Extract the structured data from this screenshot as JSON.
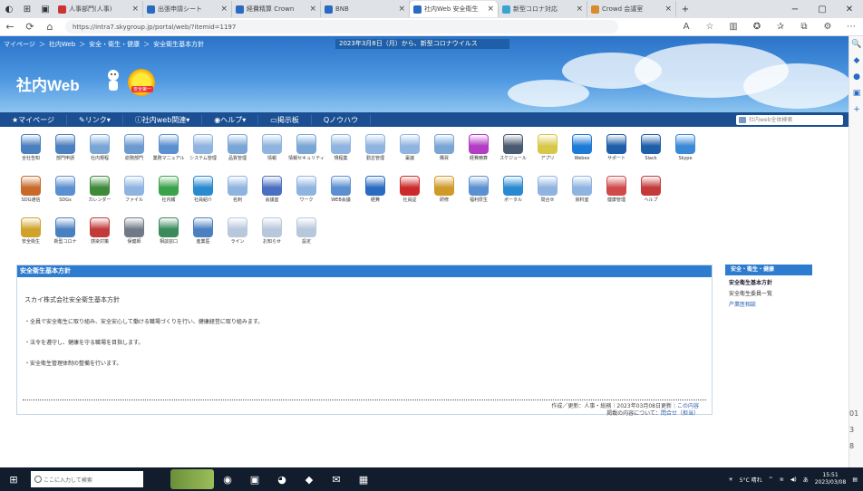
{
  "browser": {
    "tabs": [
      {
        "label": "人事部門(人事)",
        "color": "#cc3333"
      },
      {
        "label": "出張申請シート",
        "color": "#2a6bc2"
      },
      {
        "label": "経費精算 Crown",
        "color": "#2a6bc2"
      },
      {
        "label": "BNB",
        "color": "#2a6bc2"
      },
      {
        "label": "社内Web 安全衛生",
        "color": "#2a6bc2",
        "active": true
      },
      {
        "label": "新型コロナ対応",
        "color": "#3aa3d0"
      },
      {
        "label": "Crowd 会議室",
        "color": "#d98a2a"
      }
    ],
    "url": "https://intra7.skygroup.jp/portal/web/?itemid=1197",
    "new_tab": "+",
    "window_controls": [
      "−",
      "▢",
      "✕"
    ]
  },
  "banner": {
    "breadcrumb": [
      "マイページ",
      "社内Web",
      "安全・衛生・健康",
      "安全衛生基本方針"
    ],
    "notice": "2023年3月8日（月）から、新型コロナウイルス",
    "logo": "社内Web",
    "sun_label": "安全第一"
  },
  "nav": {
    "items": [
      "マイページ",
      "リンク",
      "社内web関連",
      "ヘルプ",
      "掲示板",
      "ノウハウ"
    ],
    "search_placeholder": "社内web全体検索"
  },
  "links": [
    {
      "label": "全社告知",
      "color": "#4a7fc0"
    },
    {
      "label": "部門申請",
      "color": "#4a7fc0"
    },
    {
      "label": "社内規程",
      "color": "#7aa6d6"
    },
    {
      "label": "総務部門",
      "color": "#6c9bd0"
    },
    {
      "label": "業務マニュアル",
      "color": "#5a8fd0"
    },
    {
      "label": "システム管理",
      "color": "#8fb4e0"
    },
    {
      "label": "品質管理",
      "color": "#7aa6d6"
    },
    {
      "label": "情報",
      "color": "#8fb4e0"
    },
    {
      "label": "情報セキュリティ",
      "color": "#7aa6d6"
    },
    {
      "label": "規程集",
      "color": "#8fb4e0"
    },
    {
      "label": "勤怠管理",
      "color": "#8fb4e0"
    },
    {
      "label": "稟議",
      "color": "#8fb4e0"
    },
    {
      "label": "購買",
      "color": "#7aa6d6"
    },
    {
      "label": "経費精算",
      "color": "#b23cc4"
    },
    {
      "label": "スケジュール",
      "color": "#4a5a70"
    },
    {
      "label": "アプリ",
      "color": "#d8c84a"
    },
    {
      "label": "Webex",
      "color": "#1f7ad6"
    },
    {
      "label": "サポート",
      "color": "#1f5ea8"
    },
    {
      "label": "Slack",
      "color": "#1f5ea8"
    },
    {
      "label": "Skype",
      "color": "#3b8ad8"
    },
    {
      "label": "SDG通信",
      "color": "#c86a2a"
    },
    {
      "label": "SDGs",
      "color": "#5a8fd0"
    },
    {
      "label": "カレンダー",
      "color": "#3d8a3a"
    },
    {
      "label": "ファイル",
      "color": "#8fb4e0"
    },
    {
      "label": "社内報",
      "color": "#3aa34a"
    },
    {
      "label": "社員紹介",
      "color": "#2a8ad0"
    },
    {
      "label": "名刺",
      "color": "#8fb4e0"
    },
    {
      "label": "会議室",
      "color": "#4a6fc0"
    },
    {
      "label": "ワーク",
      "color": "#8fb4e0"
    },
    {
      "label": "WEB会議",
      "color": "#5a8fd0"
    },
    {
      "label": "経費",
      "color": "#2a6bc2"
    },
    {
      "label": "社員証",
      "color": "#cc2a2a"
    },
    {
      "label": "研修",
      "color": "#d09a2a"
    },
    {
      "label": "福利厚生",
      "color": "#5a8fd0"
    },
    {
      "label": "ポータル",
      "color": "#2a8ad0"
    },
    {
      "label": "問合せ",
      "color": "#8fb4e0"
    },
    {
      "label": "資料室",
      "color": "#8fb4e0"
    },
    {
      "label": "健康管理",
      "color": "#d04a4a"
    },
    {
      "label": "ヘルプ",
      "color": "#c43a3a"
    },
    {
      "label": "安全衛生",
      "color": "#d0a22a"
    },
    {
      "label": "新型コロナ",
      "color": "#4a7fc0"
    },
    {
      "label": "感染対策",
      "color": "#c23a3a"
    },
    {
      "label": "保健師",
      "color": "#707a86"
    },
    {
      "label": "相談窓口",
      "color": "#3a8a5a"
    },
    {
      "label": "産業医",
      "color": "#4a7fc0"
    },
    {
      "label": "ライン",
      "color": "#b8c8dc"
    },
    {
      "label": "お知らせ",
      "color": "#b8c8dc"
    },
    {
      "label": "設定",
      "color": "#b8c8dc"
    }
  ],
  "panel": {
    "title": "安全衛生基本方針",
    "heading": "スカイ株式会社安全衛生基本方針",
    "lines": [
      "・全員で安全衛生に取り組み、安全安心して働ける職場づくりを行い、健康経営に取り組みます。",
      "・法令を遵守し、健康を守る職場を目指します。",
      "・安全衛生管理体制の整備を行います。"
    ],
    "footer_prefix": "作成／更新：",
    "footer_author": "人事・総務",
    "footer_date": "2023年03月08日更新",
    "footer_link1": "この内容",
    "footer_line2": "掲載の内容について：",
    "footer_link2": "問合せ（担当）"
  },
  "side": {
    "title": "安全・衛生・健康",
    "items": [
      "安全衛生基本方針",
      "安全衛生委員一覧",
      "产業医相談"
    ]
  },
  "edge_sidebar": [
    "🔍",
    "◆",
    "●",
    "▣",
    "+"
  ],
  "right_edge": [
    "01",
    "3",
    "8"
  ],
  "taskbar": {
    "search_placeholder": "ここに入力して検索",
    "apps": [
      "◉",
      "▣",
      "◕",
      "◆",
      "✉",
      "▦"
    ],
    "weather": "5°C 晴れ",
    "time": "15:51",
    "date": "2023/03/08",
    "lang": "あ"
  }
}
